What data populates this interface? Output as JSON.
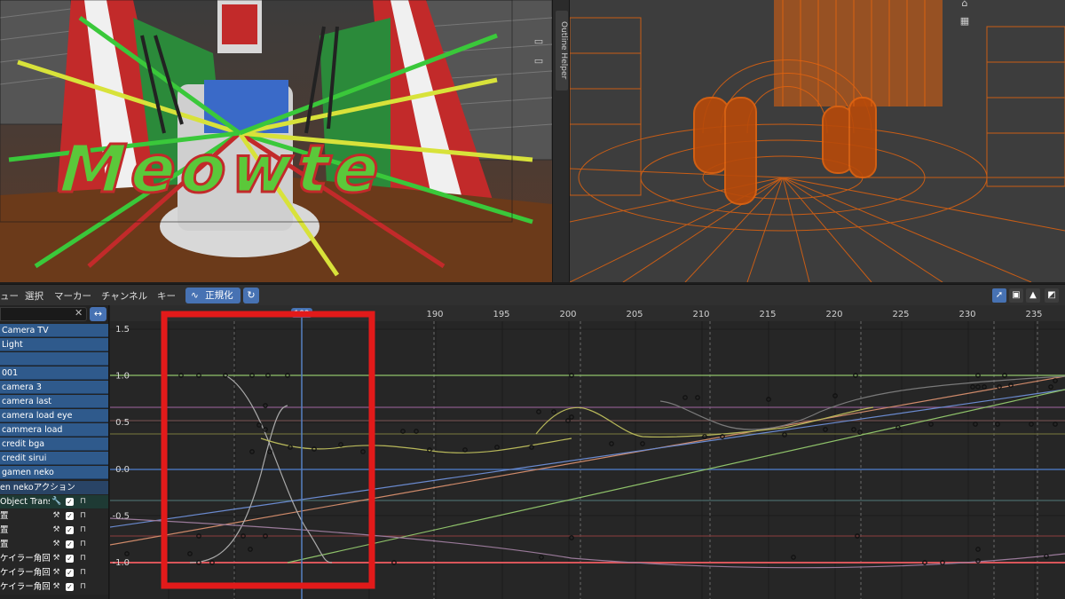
{
  "viewport_left": {
    "logo_text": "Meowte",
    "banner_text": "Meowte"
  },
  "n_panel": {
    "tab_label": "Outline Helper"
  },
  "graph_editor": {
    "menu": {
      "view": "ュー",
      "select": "選択",
      "marker": "マーカー",
      "channel": "チャンネル",
      "key": "キー"
    },
    "normalize_label": "正規化",
    "normalize_icon": "curve-icon",
    "auto_normalize_icon": "refresh-icon",
    "right_icons": [
      "cursor-icon",
      "frame-icon",
      "warning-icon",
      "overlay-icon"
    ]
  },
  "channels": {
    "search_placeholder": "",
    "objects": [
      "Camera TV",
      "Light",
      "",
      "001",
      "camera 3",
      "camera last",
      "camera load eye",
      "cammera load",
      "credit bga",
      "credit sirui",
      "gamen neko"
    ],
    "action": "en nekoアクション",
    "group": "Object Trans",
    "fcurves": [
      "置",
      "置",
      "置",
      "ケイラー角回転",
      "ケイラー角回転",
      "ケイラー角回転"
    ]
  },
  "timeline": {
    "frame_ticks": [
      "190",
      "195",
      "200",
      "205",
      "210",
      "215",
      "220",
      "225",
      "230",
      "235"
    ],
    "current_frame": "183",
    "current_frame_value": 183,
    "y_ticks": [
      "1.5",
      "1.0",
      "0.5",
      "0.0",
      "-0.5",
      "-1.0"
    ]
  },
  "colors": {
    "accent": "#4772b3",
    "highlight_box": "#e21a1a",
    "wireframe": "#e2630f",
    "playhead": "#5680c2"
  }
}
